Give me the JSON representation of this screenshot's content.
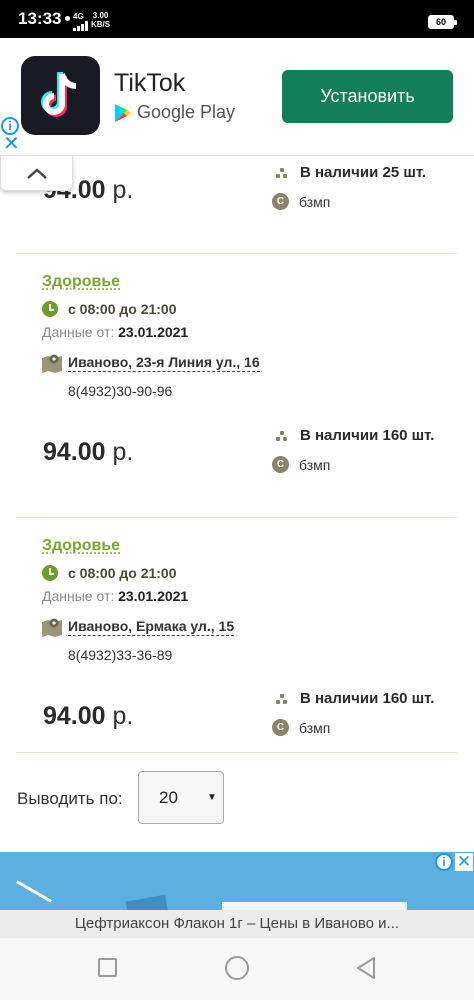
{
  "status_bar": {
    "time": "13:33",
    "network": "4G",
    "speed_value": "3.00",
    "speed_unit": "KB/S",
    "battery": "60"
  },
  "ad_top": {
    "app_name": "TikTok",
    "store": "Google Play",
    "install_label": "Установить",
    "info_glyph": "i",
    "close_glyph": "✕"
  },
  "listings": [
    {
      "price_value": "94.00",
      "currency": "р.",
      "stock": "В наличии 25 шт.",
      "supplier": "бзмп"
    },
    {
      "shop": "Здоровье",
      "hours": "с 08:00 до 21:00",
      "data_label": "Данные от:",
      "data_date": "23.01.2021",
      "address": "Иваново, 23-я Линия ул., 16",
      "phone": "8(4932)30-90-96",
      "price_value": "94.00",
      "currency": "р.",
      "stock": "В наличии 160 шт.",
      "supplier": "бзмп"
    },
    {
      "shop": "Здоровье",
      "hours": "с 08:00 до 21:00",
      "data_label": "Данные от:",
      "data_date": "23.01.2021",
      "address": "Иваново, Ермака ул., 15",
      "phone": "8(4932)33-36-89",
      "price_value": "94.00",
      "currency": "р.",
      "stock": "В наличии 160 шт.",
      "supplier": "бзмп"
    }
  ],
  "supplier_badge": "С",
  "pagination": {
    "label": "Выводить по:",
    "selected": "20"
  },
  "ad_bottom": {
    "info_glyph": "i",
    "close_glyph": "✕"
  },
  "page_title": "Цефтриаксон Флакон 1г – Цены в Иваново и...",
  "colors": {
    "accent_green": "#7ba62d",
    "install_button": "#137e5a",
    "ad_icon_blue": "#1a9bd7"
  },
  "icons": [
    "tiktok-logo",
    "google-play-icon",
    "info-icon",
    "close-icon",
    "chevron-up-icon",
    "clock-icon",
    "map-pin-icon",
    "stock-dots-icon",
    "supplier-c-icon",
    "dropdown-arrow-icon",
    "nav-recent-icon",
    "nav-home-icon",
    "nav-back-icon"
  ]
}
